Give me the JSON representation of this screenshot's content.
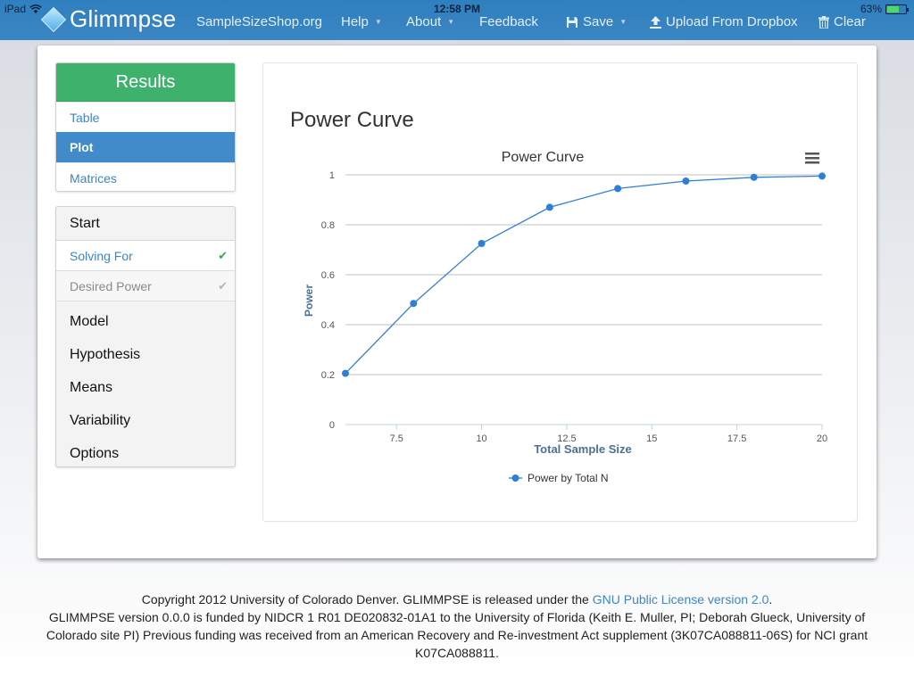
{
  "status_bar": {
    "device": "iPad",
    "time": "12:58 PM",
    "battery_percent": "63%",
    "battery_level": 0.63
  },
  "navbar": {
    "brand": "Glimmpse",
    "links": {
      "samplesizeshop": "SampleSizeShop.org",
      "help": "Help",
      "about": "About",
      "feedback": "Feedback",
      "save": "Save",
      "upload": "Upload From Dropbox",
      "clear": "Clear"
    }
  },
  "sidebar": {
    "results_title": "Results",
    "results_items": [
      "Table",
      "Plot",
      "Matrices"
    ],
    "active_result": "Plot",
    "start": "Start",
    "substeps": [
      "Solving For",
      "Desired Power"
    ],
    "steps": [
      "Model",
      "Hypothesis",
      "Means",
      "Variability",
      "Options"
    ]
  },
  "main": {
    "heading": "Power Curve"
  },
  "chart_data": {
    "type": "line",
    "title": "Power Curve",
    "xlabel": "Total Sample Size",
    "ylabel": "Power",
    "xlim": [
      6,
      20
    ],
    "ylim": [
      0,
      1
    ],
    "x_ticks": [
      "7.5",
      "10",
      "12.5",
      "15",
      "17.5",
      "20"
    ],
    "y_ticks": [
      "0",
      "0.2",
      "0.4",
      "0.6",
      "0.8",
      "1"
    ],
    "grid": true,
    "legend_position": "bottom",
    "series": [
      {
        "name": "Power by Total N",
        "color": "#2f7ed8",
        "x": [
          6,
          8,
          10,
          12,
          14,
          16,
          18,
          20
        ],
        "y": [
          0.205,
          0.485,
          0.725,
          0.87,
          0.945,
          0.975,
          0.99,
          0.995
        ]
      }
    ]
  },
  "footer": {
    "line1_prefix": "Copyright 2012 University of Colorado Denver. GLIMMPSE is released under the ",
    "license_link": "GNU Public License version 2.0",
    "line1_suffix": ".",
    "line2": "GLIMMPSE version 0.0.0 is funded by NIDCR 1 R01 DE020832-01A1 to the University of Florida (Keith E. Muller, PI; Deborah Glueck, University of Colorado site PI) Previous funding was received from an American Recovery and Re-investment Act supplement (3K07CA088811-06S) for NCI grant K07CA088811."
  },
  "colors": {
    "navbar": "#3a86c2",
    "results_header": "#3eb16d",
    "active_item": "#428bca",
    "link": "#3c86c7",
    "series": "#2f7ed8"
  }
}
